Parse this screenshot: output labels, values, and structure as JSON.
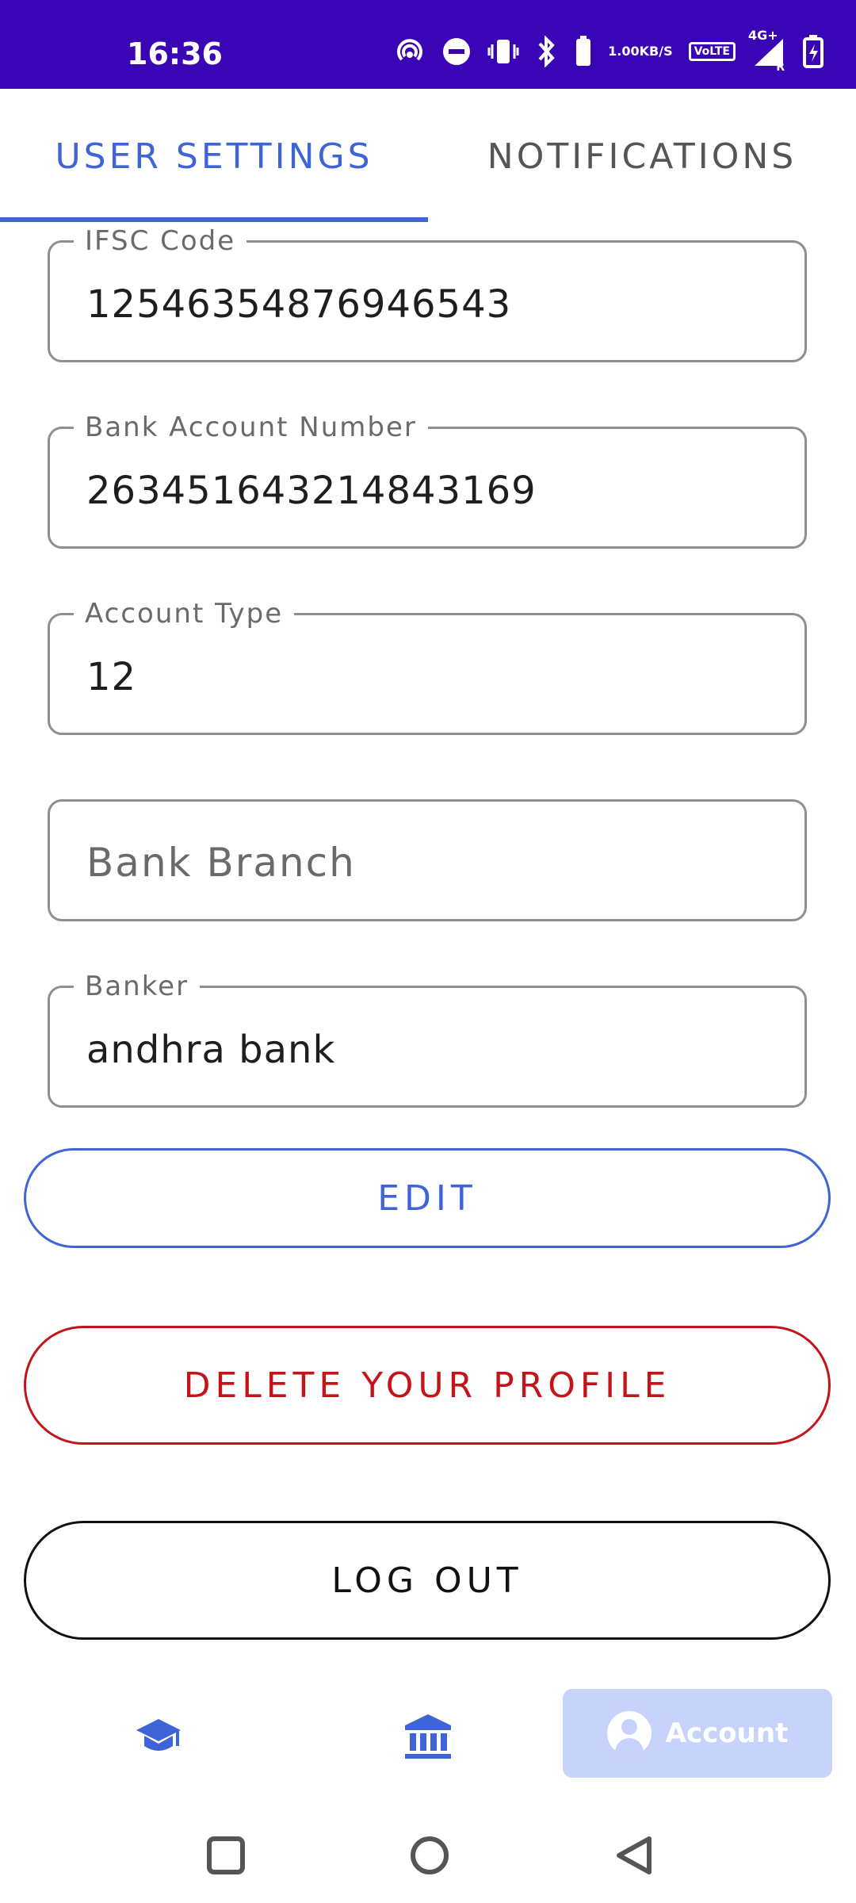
{
  "status_bar": {
    "time": "16:36",
    "speed_value": "1.00",
    "speed_unit": "KB/S",
    "volte": "VoLTE",
    "network": "4G+",
    "roaming": "R"
  },
  "tabs": [
    {
      "label": "USER SETTINGS",
      "selected": true
    },
    {
      "label": "NOTIFICATIONS",
      "selected": false
    }
  ],
  "fields": {
    "ifsc": {
      "label": "IFSC Code",
      "value": "12546354876946543"
    },
    "account_number": {
      "label": "Bank Account Number",
      "value": "263451643214843169"
    },
    "account_type": {
      "label": "Account Type",
      "value": "12"
    },
    "bank_branch": {
      "placeholder": "Bank Branch",
      "value": ""
    },
    "banker": {
      "label": "Banker",
      "value": "andhra bank"
    }
  },
  "buttons": {
    "edit": "EDIT",
    "delete": "DELETE YOUR PROFILE",
    "logout": "LOG OUT"
  },
  "bottom_nav": {
    "account_label": "Account",
    "items": [
      {
        "icon": "graduation-cap-icon"
      },
      {
        "icon": "bank-icon"
      },
      {
        "icon": "account-circle-icon",
        "label": "Account",
        "selected": true
      }
    ]
  },
  "colors": {
    "status_bar": "#3a05b5",
    "accent": "#3e64d6",
    "danger": "#c4141a",
    "nav_selected_bg": "#c8d3fb"
  }
}
